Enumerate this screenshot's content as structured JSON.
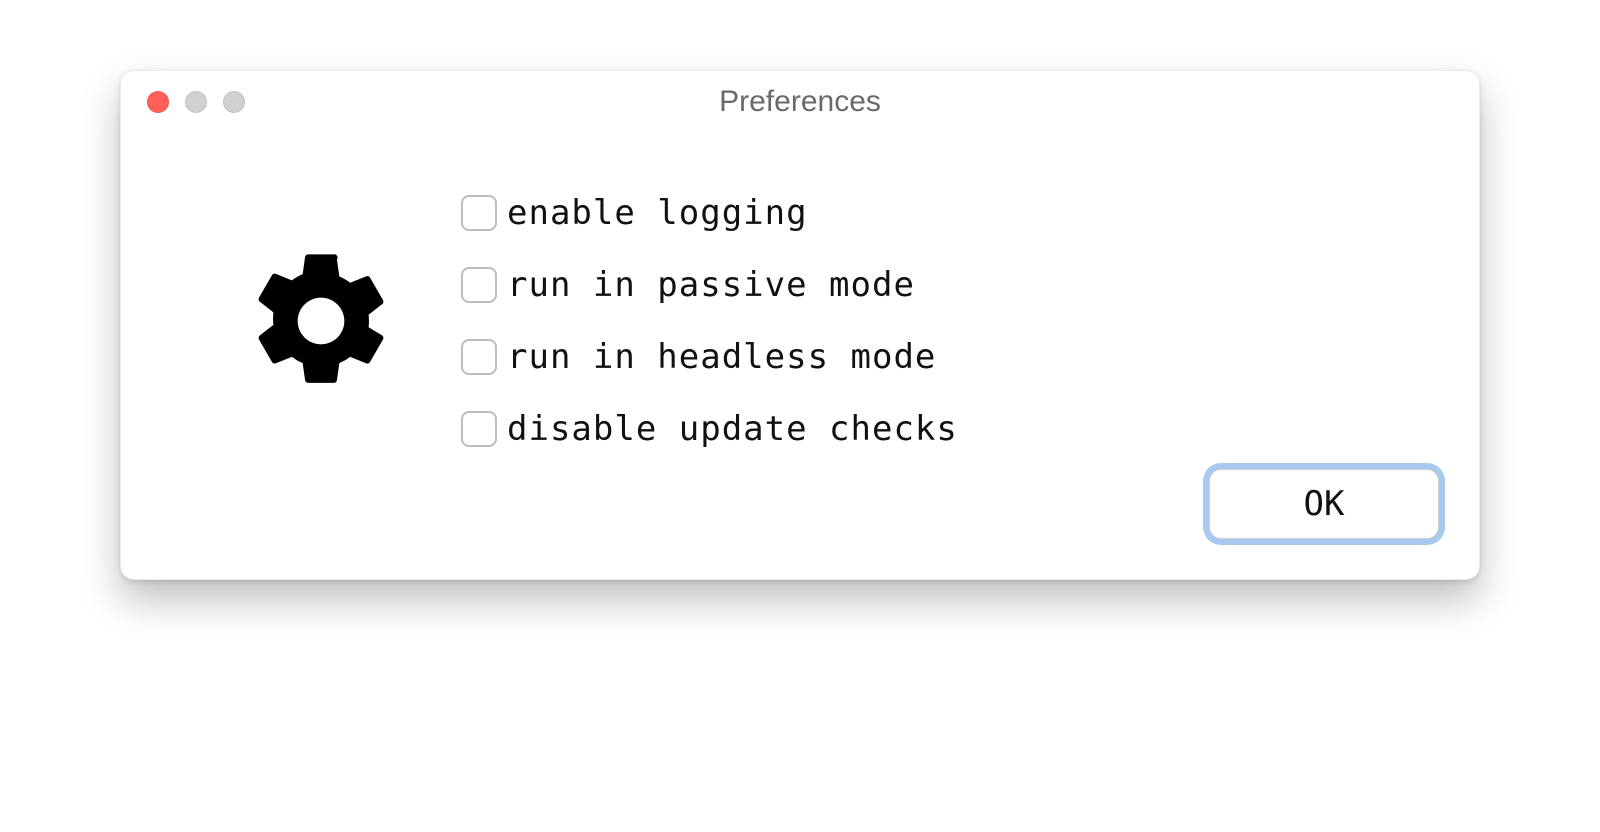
{
  "window": {
    "title": "Preferences"
  },
  "options": [
    {
      "name": "enable-logging",
      "label": "enable logging",
      "checked": false
    },
    {
      "name": "run-passive-mode",
      "label": "run in passive mode",
      "checked": false
    },
    {
      "name": "run-headless-mode",
      "label": "run in headless mode",
      "checked": false
    },
    {
      "name": "disable-update-checks",
      "label": "disable update checks",
      "checked": false
    }
  ],
  "buttons": {
    "ok": "OK"
  },
  "icons": {
    "gear": "gear-icon"
  }
}
